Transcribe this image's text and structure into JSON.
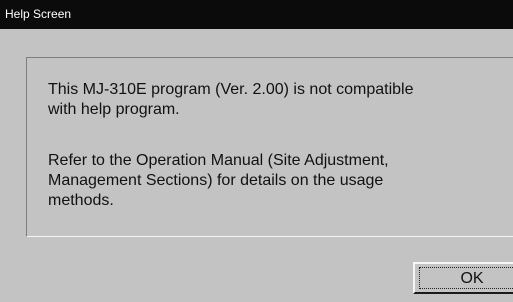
{
  "window": {
    "title": "Help Screen"
  },
  "message": {
    "paragraph1": " This MJ-310E program (Ver. 2.00) is not compatible\nwith help program.",
    "paragraph2": " Refer to the Operation Manual (Site Adjustment,\nManagement Sections) for details on the usage\nmethods."
  },
  "buttons": {
    "ok_label": "OK"
  },
  "colors": {
    "title_bar": "#0b0b0b",
    "title_text": "#ffffff",
    "window_background": "#c3c3c3",
    "text": "#111111"
  }
}
